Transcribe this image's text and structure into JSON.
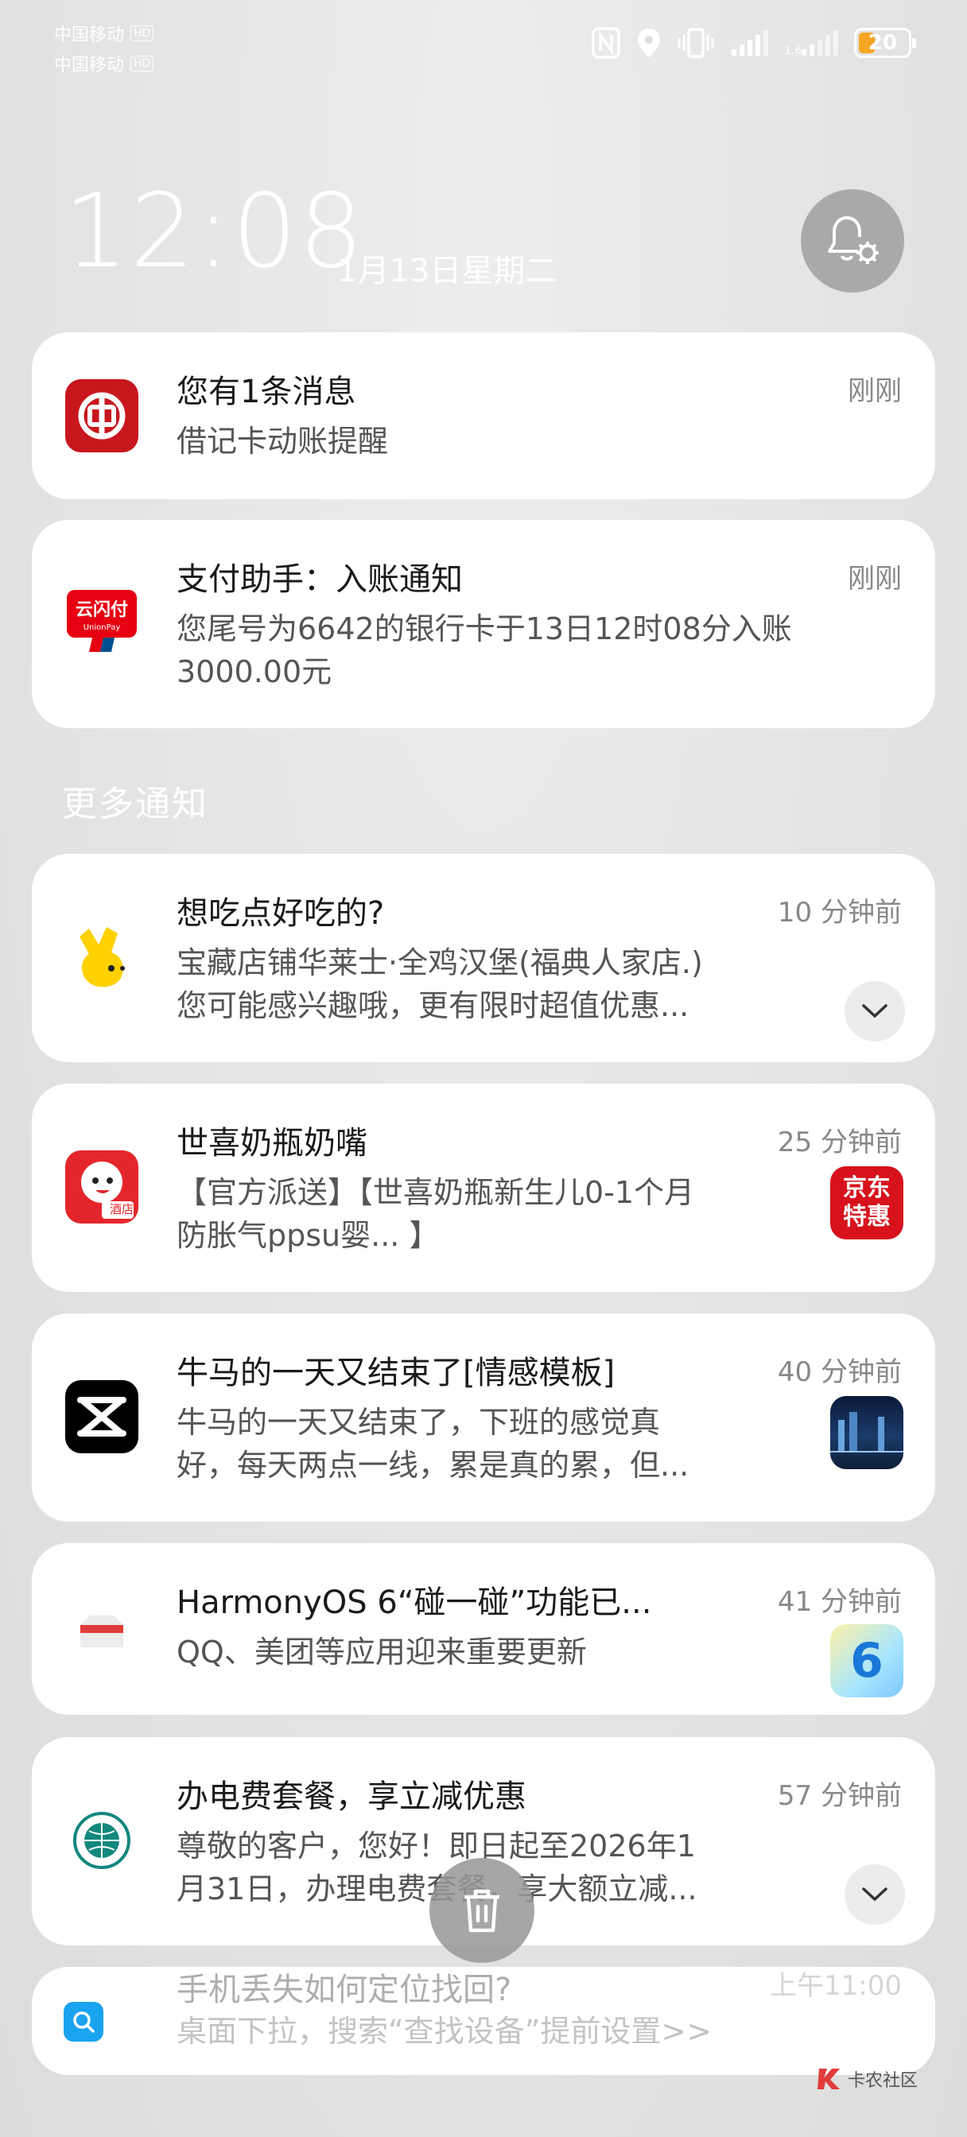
{
  "status_bar": {
    "carrier1": "中国移动",
    "carrier2": "中国移动",
    "hd": "HD",
    "battery": "20"
  },
  "lock": {
    "time": "12:08",
    "date": "1月13日星期二"
  },
  "notifications": [
    {
      "title": "您有1条消息",
      "time": "刚刚",
      "body": "借记卡动账提醒"
    },
    {
      "title": "支付助手：入账通知",
      "time": "刚刚",
      "body": "您尾号为6642的银行卡于13日12时08分入账",
      "body2": "3000.00元"
    }
  ],
  "more_label": "更多通知",
  "more": [
    {
      "title": "想吃点好吃的?",
      "time": "10 分钟前",
      "body": "宝藏店铺华莱士·全鸡汉堡(福典人家店.)",
      "body2": "您可能感兴趣哦，更有限时超值优惠..."
    },
    {
      "title": "世喜奶瓶奶嘴",
      "time": "25 分钟前",
      "body": "【官方派送】【世喜奶瓶新生儿0-1个月",
      "body2": "防胀气ppsu婴... 】",
      "thumb_text": "京东特惠"
    },
    {
      "title": "牛马的一天又结束了[情感模板]",
      "time": "40 分钟前",
      "body": "牛马的一天又结束了，下班的感觉真",
      "body2": "好，每天两点一线，累是真的累，但..."
    },
    {
      "title": "HarmonyOS 6“碰一碰”功能已...",
      "time": "41 分钟前",
      "body": "QQ、美团等应用迎来重要更新",
      "thumb_text": "6"
    },
    {
      "title": "办电费套餐，享立减优惠",
      "time": "57 分钟前",
      "body": "尊敬的客户，您好！即日起至2026年1",
      "body2": "月31日，办理电费套餐，享大额立减..."
    },
    {
      "title": "手机丢失如何定位找回?",
      "time": "上午11:00",
      "body": "桌面下拉，搜索“查找设备”提前设置>>"
    }
  ],
  "jd_icon_label": "酒店",
  "watermark": "卡农社区"
}
